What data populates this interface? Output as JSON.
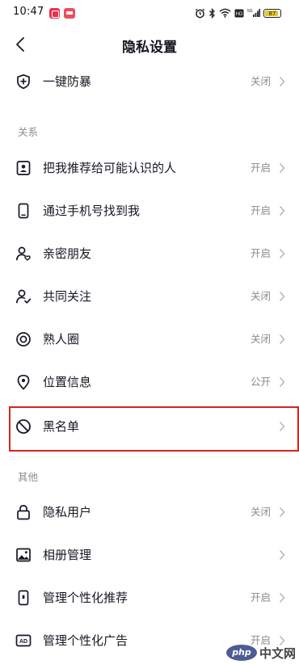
{
  "status_bar": {
    "time": "10:47",
    "battery": "87",
    "battery_level": 0.87,
    "battery_color": "#e7c62e",
    "network": "5G",
    "hd": "HD",
    "icons": [
      "alarm-icon",
      "bluetooth-icon",
      "wifi-icon",
      "hd-icon",
      "signal-icon",
      "battery-icon"
    ]
  },
  "nav": {
    "back_icon": "chevron-left-icon",
    "title": "隐私设置"
  },
  "top_item": {
    "label": "一键防暴",
    "value": "关闭",
    "icon": "shield-plus-icon"
  },
  "sections": [
    {
      "title": "关系",
      "items": [
        {
          "label": "把我推荐给可能认识的人",
          "value": "开启",
          "icon": "contact-card-icon"
        },
        {
          "label": "通过手机号找到我",
          "value": "开启",
          "icon": "phone-icon"
        },
        {
          "label": "亲密朋友",
          "value": "开启",
          "icon": "user-heart-icon"
        },
        {
          "label": "共同关注",
          "value": "关闭",
          "icon": "user-check-icon"
        },
        {
          "label": "熟人圈",
          "value": "关闭",
          "icon": "circle-target-icon"
        },
        {
          "label": "位置信息",
          "value": "公开",
          "icon": "location-pin-icon"
        },
        {
          "label": "黑名单",
          "value": "",
          "icon": "block-icon",
          "highlighted": true
        }
      ]
    },
    {
      "title": "其他",
      "items": [
        {
          "label": "隐私用户",
          "value": "关闭",
          "icon": "lock-icon"
        },
        {
          "label": "相册管理",
          "value": "",
          "icon": "image-icon"
        },
        {
          "label": "管理个性化推荐",
          "value": "开启",
          "icon": "phone-screen-icon"
        },
        {
          "label": "管理个性化广告",
          "value": "开启",
          "icon": "ad-icon"
        }
      ]
    }
  ],
  "highlight_color": "#d8231d",
  "watermark": {
    "logo": "php",
    "text": "中文网"
  }
}
